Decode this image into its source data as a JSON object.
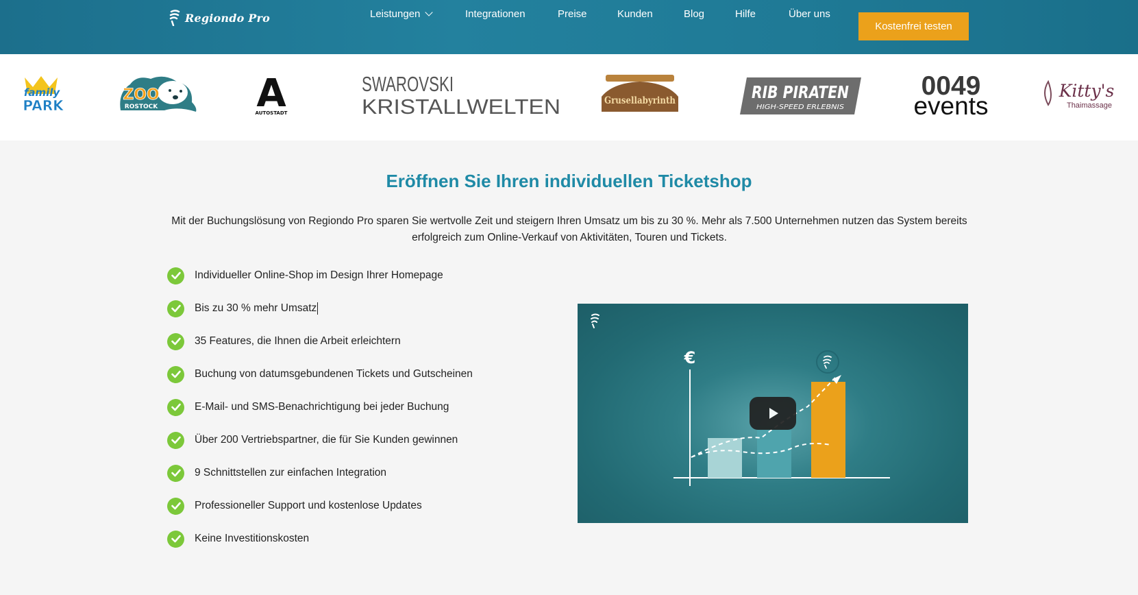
{
  "header": {
    "logo_text": "Regiondo Pro",
    "nav": [
      {
        "label": "Leistungen",
        "has_dropdown": true
      },
      {
        "label": "Integrationen"
      },
      {
        "label": "Preise"
      },
      {
        "label": "Kunden"
      },
      {
        "label": "Blog"
      },
      {
        "label": "Hilfe"
      },
      {
        "label": "Über uns"
      }
    ],
    "cta_label": "Kostenfrei testen"
  },
  "customer_logos": {
    "family_park": {
      "line1": "family",
      "line2": "PARK"
    },
    "zoo_rostock": {
      "line1": "ZOO",
      "line2": "ROSTOCK"
    },
    "autostadt": {
      "letter": "A",
      "caption": "AUTOSTADT"
    },
    "swarovski": {
      "line1": "SWAROVSKI",
      "line2": "KRISTALLWELTEN"
    },
    "grusellabyrinth": {
      "line1": "Grusellabyrinth"
    },
    "rib_piraten": {
      "line1": "RIB PIRATEN",
      "line2": "HIGH-SPEED ERLEBNIS"
    },
    "events_0049": {
      "line1": "0049",
      "line2": "events"
    },
    "kittys": {
      "line1": "Kitty's",
      "line2": "Thaimassage"
    }
  },
  "main": {
    "title": "Eröffnen Sie Ihren individuellen Ticketshop",
    "intro": "Mit der Buchungslösung von Regiondo Pro sparen Sie wertvolle Zeit und steigern Ihren Umsatz um bis zu 30 %. Mehr als 7.500 Unternehmen nutzen das System bereits erfolgreich zum Online-Verkauf von Aktivitäten, Touren und Tickets.",
    "features": [
      "Individueller Online-Shop im Design Ihrer Homepage",
      "Bis zu 30 % mehr Umsatz",
      "35 Features, die Ihnen die Arbeit erleichtern",
      "Buchung von datumsgebundenen Tickets und Gutscheinen",
      "E-Mail- und SMS-Benachrichtigung bei jeder Buchung",
      "Über 200 Vertriebspartner, die für Sie Kunden gewinnen",
      "9 Schnittstellen zur einfachen Integration",
      "Professioneller Support und kostenlose Updates",
      "Keine Investitionskosten"
    ],
    "video": {
      "currency_symbol": "€"
    }
  },
  "colors": {
    "header": "#23819e",
    "accent": "#eba11b",
    "title": "#1f8aa6",
    "check": "#7cc83a"
  }
}
